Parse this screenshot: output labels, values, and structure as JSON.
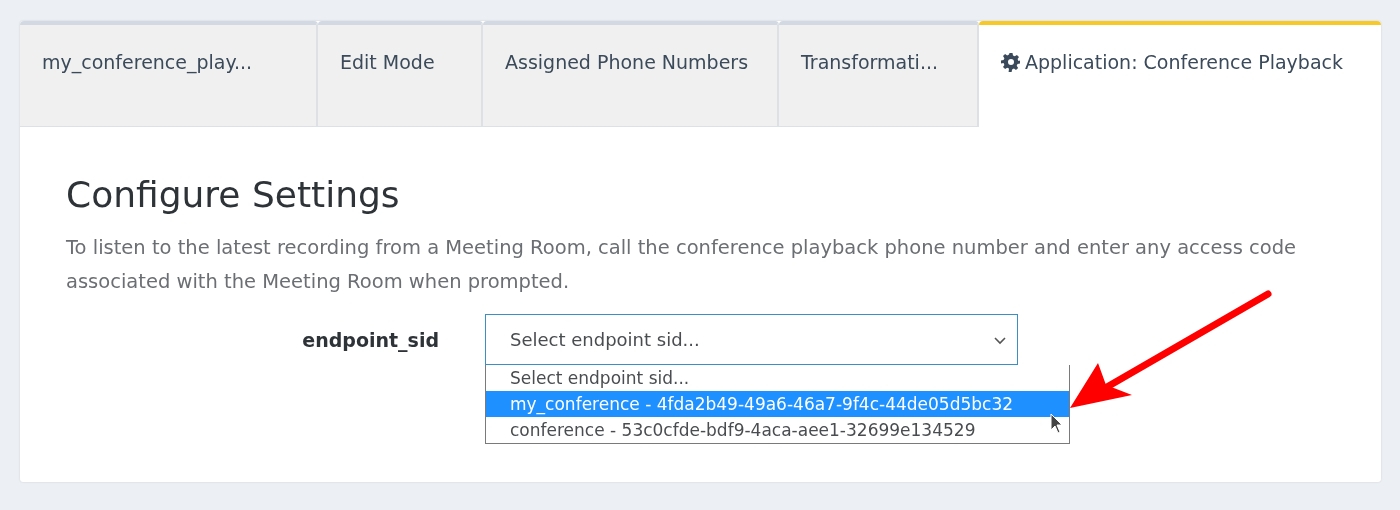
{
  "tabs": [
    {
      "label": "my_conference_play...",
      "selected": false,
      "kind": "text"
    },
    {
      "label": "Edit Mode",
      "selected": false,
      "kind": "text"
    },
    {
      "label": "Assigned Phone Numbers",
      "selected": false,
      "kind": "text"
    },
    {
      "label": "Transformati...",
      "selected": false,
      "kind": "text"
    },
    {
      "label": "Application: Conference Playback",
      "selected": true,
      "kind": "settings"
    }
  ],
  "heading": "Configure Settings",
  "description": "To listen to the latest recording from a Meeting Room, call the conference playback phone number and enter any access code associated with the Meeting Room when prompted.",
  "field": {
    "label": "endpoint_sid",
    "value": "Select endpoint sid...",
    "expanded": true,
    "options": [
      {
        "label": "Select endpoint sid...",
        "highlighted": false
      },
      {
        "label": "my_conference - 4fda2b49-49a6-46a7-9f4c-44de05d5bc32",
        "highlighted": true
      },
      {
        "label": "conference - 53c0cfde-bdf9-4aca-aee1-32699e134529",
        "highlighted": false
      }
    ]
  }
}
